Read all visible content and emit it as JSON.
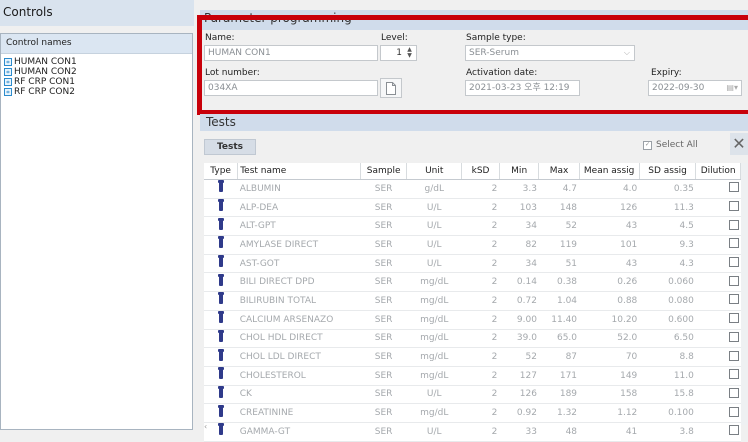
{
  "controls": {
    "title": "Controls",
    "list_header": "Control names",
    "items": [
      "HUMAN CON1",
      "HUMAN CON2",
      "RF CRP CON1",
      "RF CRP CON2"
    ]
  },
  "param": {
    "title": "Parameter programming",
    "name_label": "Name:",
    "name_value": "HUMAN CON1",
    "level_label": "Level:",
    "level_value": "1",
    "sample_label": "Sample type:",
    "sample_value": "SER-Serum",
    "lot_label": "Lot number:",
    "lot_value": "034XA",
    "activation_label": "Activation date:",
    "activation_value": "2021-03-23 오후 12:19",
    "expiry_label": "Expiry:",
    "expiry_value": "2022-09-30"
  },
  "tests": {
    "title": "Tests",
    "button": "Tests",
    "select_all": "Select All",
    "columns": [
      "Type",
      "Test name",
      "Sample",
      "Unit",
      "kSD",
      "Min",
      "Max",
      "Mean assig",
      "SD assig",
      "Dilution"
    ],
    "rows": [
      {
        "name": "ALBUMIN",
        "sample": "SER",
        "unit": "g/dL",
        "ksd": "2",
        "min": "3.3",
        "max": "4.7",
        "mean": "4.0",
        "sd": "0.35"
      },
      {
        "name": "ALP-DEA",
        "sample": "SER",
        "unit": "U/L",
        "ksd": "2",
        "min": "103",
        "max": "148",
        "mean": "126",
        "sd": "11.3"
      },
      {
        "name": "ALT-GPT",
        "sample": "SER",
        "unit": "U/L",
        "ksd": "2",
        "min": "34",
        "max": "52",
        "mean": "43",
        "sd": "4.5"
      },
      {
        "name": "AMYLASE DIRECT",
        "sample": "SER",
        "unit": "U/L",
        "ksd": "2",
        "min": "82",
        "max": "119",
        "mean": "101",
        "sd": "9.3"
      },
      {
        "name": "AST-GOT",
        "sample": "SER",
        "unit": "U/L",
        "ksd": "2",
        "min": "34",
        "max": "51",
        "mean": "43",
        "sd": "4.3"
      },
      {
        "name": "BILI DIRECT DPD",
        "sample": "SER",
        "unit": "mg/dL",
        "ksd": "2",
        "min": "0.14",
        "max": "0.38",
        "mean": "0.26",
        "sd": "0.060"
      },
      {
        "name": "BILIRUBIN TOTAL",
        "sample": "SER",
        "unit": "mg/dL",
        "ksd": "2",
        "min": "0.72",
        "max": "1.04",
        "mean": "0.88",
        "sd": "0.080"
      },
      {
        "name": "CALCIUM ARSENAZO",
        "sample": "SER",
        "unit": "mg/dL",
        "ksd": "2",
        "min": "9.00",
        "max": "11.40",
        "mean": "10.20",
        "sd": "0.600"
      },
      {
        "name": "CHOL HDL DIRECT",
        "sample": "SER",
        "unit": "mg/dL",
        "ksd": "2",
        "min": "39.0",
        "max": "65.0",
        "mean": "52.0",
        "sd": "6.50"
      },
      {
        "name": "CHOL LDL DIRECT",
        "sample": "SER",
        "unit": "mg/dL",
        "ksd": "2",
        "min": "52",
        "max": "87",
        "mean": "70",
        "sd": "8.8"
      },
      {
        "name": "CHOLESTEROL",
        "sample": "SER",
        "unit": "mg/dL",
        "ksd": "2",
        "min": "127",
        "max": "171",
        "mean": "149",
        "sd": "11.0"
      },
      {
        "name": "CK",
        "sample": "SER",
        "unit": "U/L",
        "ksd": "2",
        "min": "126",
        "max": "189",
        "mean": "158",
        "sd": "15.8"
      },
      {
        "name": "CREATININE",
        "sample": "SER",
        "unit": "mg/dL",
        "ksd": "2",
        "min": "0.92",
        "max": "1.32",
        "mean": "1.12",
        "sd": "0.100"
      },
      {
        "name": "GAMMA-GT",
        "sample": "SER",
        "unit": "U/L",
        "ksd": "2",
        "min": "33",
        "max": "48",
        "mean": "41",
        "sd": "3.8"
      }
    ]
  },
  "colors": {
    "highlight_frame": "#c8000a",
    "type_icon": "#2f3a8a"
  }
}
